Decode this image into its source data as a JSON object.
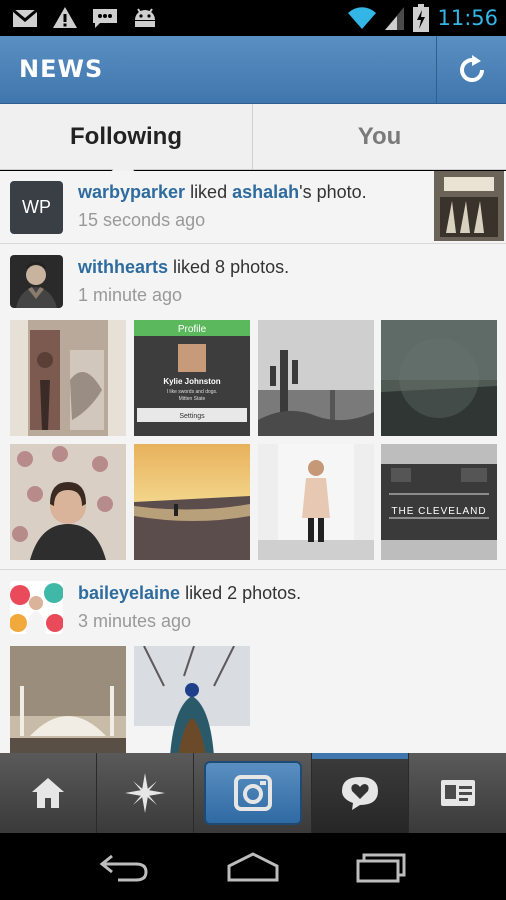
{
  "status_bar": {
    "time": "11:56",
    "icons": [
      "gmail-icon",
      "warning-icon",
      "sms-icon",
      "android-icon",
      "wifi-icon",
      "signal-icon",
      "battery-charging-icon"
    ]
  },
  "action_bar": {
    "title": "NEWS",
    "refresh_icon": "refresh-icon"
  },
  "tabs": [
    {
      "label": "Following",
      "selected": true
    },
    {
      "label": "You",
      "selected": false
    }
  ],
  "feed": [
    {
      "user": "warbyparker",
      "avatar_text": "WP",
      "action_pre": " liked ",
      "target_user": "ashalah",
      "action_post": "'s photo.",
      "time": "15 seconds ago"
    },
    {
      "user": "withhearts",
      "action": " liked 8 photos.",
      "time": "1 minute ago",
      "photo_text": {
        "profile_title": "Profile",
        "profile_name": "Kylie Johnston",
        "profile_bio": "I like swords and dogs.",
        "profile_location": "Mitten State",
        "profile_settings": "Settings",
        "cleveland_sign": "THE CLEVELAND"
      }
    },
    {
      "user": "baileyelaine",
      "action": " liked 2 photos.",
      "time": "3 minutes ago"
    }
  ],
  "bottom_nav": [
    {
      "name": "home",
      "icon": "home-icon"
    },
    {
      "name": "explore",
      "icon": "explore-star-icon"
    },
    {
      "name": "camera",
      "icon": "camera-icon"
    },
    {
      "name": "activity",
      "icon": "activity-heart-bubble-icon",
      "selected": true
    },
    {
      "name": "profile",
      "icon": "profile-card-icon"
    }
  ],
  "system_nav": [
    "back-icon",
    "home-outline-icon",
    "recent-apps-icon"
  ],
  "colors": {
    "accent_blue": "#3f76ad",
    "username_blue": "#2e6b9e",
    "status_blue": "#33b5e5"
  }
}
